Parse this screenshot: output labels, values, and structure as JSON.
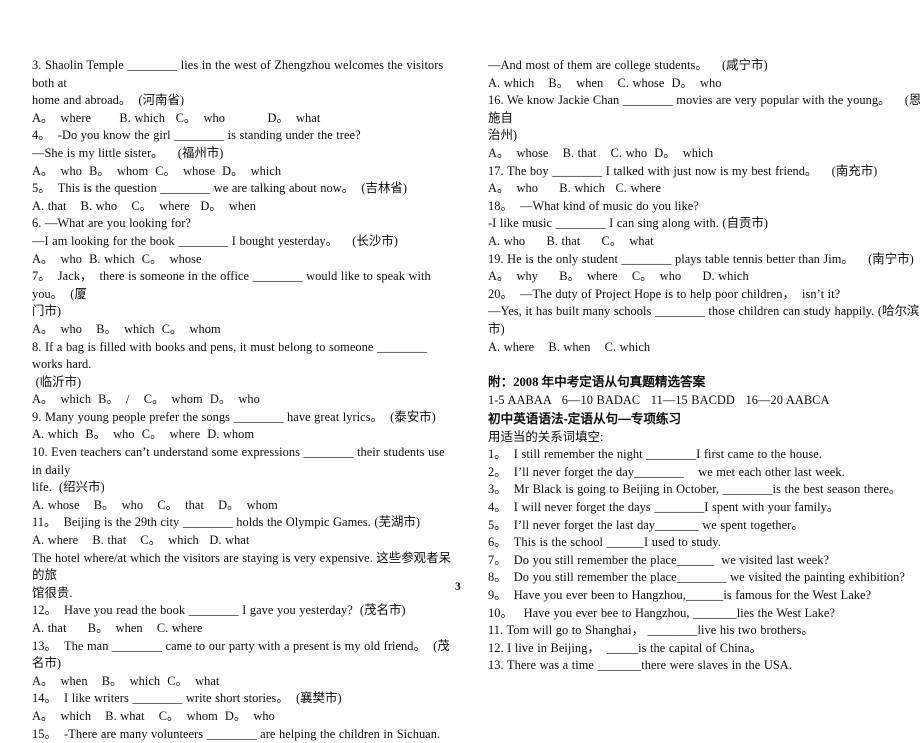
{
  "document": {
    "page_number": "3",
    "title": "2008年中考定语从句真题精选"
  },
  "left_column": {
    "lines": [
      "3. Shaolin Temple ________ lies in the west of Zhengzhou welcomes the visitors both at",
      "home and abroad。  (河南省)",
      "A。  where        B. which   C。  who            D。  what",
      "4。  -Do you know the girl ________ is standing under the tree?",
      "—She is my little sister。    (福州市)",
      "A。  who  B。  whom  C。  whose  D。  which",
      "5。  This is the question ________ we are talking about now。  (吉林省)",
      "A. that    B. who    C。  where   D。  when",
      "6. —What are you looking for?",
      "—I am looking for the book ________ I bought yesterday。    (长沙市)",
      "A。  who  B. which  C。  whose",
      "7。  Jack，  there is someone in the office ________ would like to speak with you。  (厦",
      "门市)",
      "A。  who    B。  which  C。  whom",
      "8. If a bag is filled with books and pens, it must belong to someone ________ works hard.",
      " (临沂市)",
      "A。  which  B。  /    C。  whom  D。  who",
      "9. Many young people prefer the songs ________ have great lyrics。  (泰安市)",
      "A. which  B。  who  C。  where  D. whom",
      "10. Even teachers can’t understand some expressions ________ their students use in daily",
      "life.  (绍兴市)",
      "A. whose    B。  who    C。  that    D。  whom",
      "11。  Beijing is the 29th city ________ holds the Olympic Games. (芜湖市)",
      "A. where    B. that    C。  which   D. what",
      "The hotel where/at which the visitors are staying is very expensive. 这些参观者呆的旅",
      "馆很贵.",
      "12。  Have you read the book ________ I gave you yesterday?  (茂名市)",
      "A. that      B。  when    C. where",
      "13。  The man ________ came to our party with a present is my old friend。  (茂名市)",
      "A。  when    B。  which  C。  what",
      "14。  I like writers ________ write short stories。  (襄樊市)",
      "A。  which    B. what    C。  whom  D。  who",
      "15。  -There are many volunteers ________ are helping the children in Sichuan."
    ]
  },
  "right_column": {
    "lines_top": [
      "—And most of them are college students。    (咸宁市)",
      "A. which    B。  when    C. whose  D。  who",
      "16. We know Jackie Chan ________ movies are very popular with the young。    (恩施自",
      "治州)",
      "A。  whose    B. that    C. who  D。  which",
      "17. The boy ________ I talked with just now is my best friend。    (南充市)",
      "A。  who      B. which   C. where",
      "18。  —What kind of music do you like?",
      "-I like music ________ I can sing along with. (自贡市)",
      "A. who      B. that      C。  what",
      "19. He is the only student ________ plays table tennis better than Jim。    (南宁市)",
      "A。  why      B。  where    C。  who      D. which",
      "20。  —The duty of Project Hope is to help poor children，  isn’t it?",
      "—Yes, it has built many schools ________ those children can study happily. (哈尔滨市)",
      "A. where    B. when    C. which"
    ],
    "answer_heading": "附：2008 年中考定语从句真题精选答案",
    "answer_key": "1-5 AABAA   6—10 BADAC   11—15 BACDD   16—20 AABCA",
    "practice_heading": "初中英语语法-定语从句—专项练习",
    "practice_instruction": "用适当的关系词填空:",
    "practice_items": [
      "1。  I still remember the night ________I first came to the house.",
      "2。  I’ll never forget the day________    we met each other last week.",
      "3。  Mr Black is going to Beijing in October, ________is the best season there。",
      "4。  I will never forget the days ________I spent with your family。",
      "5。  I’ll never forget the last day_______ we spent together。",
      "6。  This is the school ______I used to study.",
      "7。  Do you still remember the place______  we visited last week?",
      "8。  Do you still remember the place________ we visited the painting exhibition?",
      "9。  Have you ever been to Hangzhou,______is famous for the West Lake?",
      "10。   Have you ever bee to Hangzhou, _______lies the West Lake?",
      "11. Tom will go to Shanghai， ________live his two brothers。",
      "12. I live in Beijing，  _____is the capital of China。",
      "13. There was a time _______there were slaves in the USA."
    ]
  }
}
